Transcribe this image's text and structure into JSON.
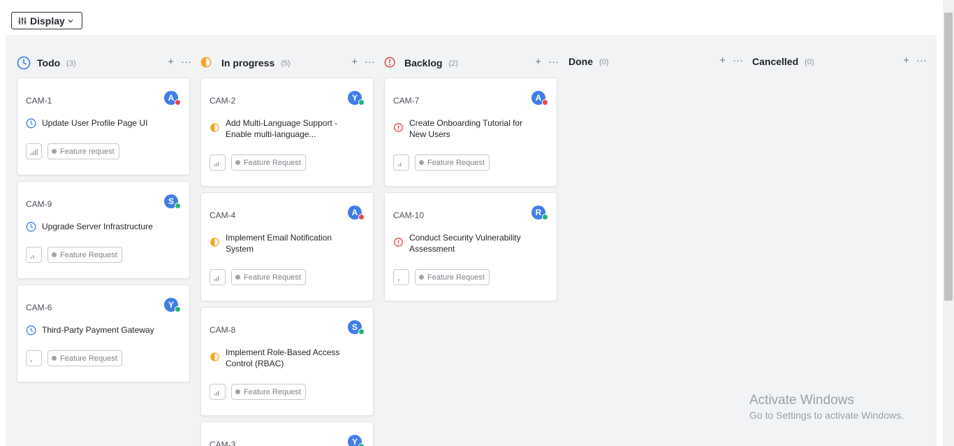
{
  "toolbar": {
    "display_label": "Display"
  },
  "columns": [
    {
      "key": "todo",
      "title": "Todo",
      "count": "(3)",
      "icon": "clock-icon",
      "color": "#3b7ddd",
      "cards": [
        {
          "id": "CAM-1",
          "title": "Update User Profile Page UI",
          "avatar": "A",
          "presence": "#e5484d",
          "priority": 4,
          "tag": "Feature request"
        },
        {
          "id": "CAM-9",
          "title": "Upgrade Server Infrastructure",
          "avatar": "S",
          "presence": "#22b573",
          "priority": 2,
          "tag": "Feature Request"
        },
        {
          "id": "CAM-6",
          "title": "Third-Party Payment Gateway",
          "avatar": "Y",
          "presence": "#22b573",
          "priority": 1,
          "tag": "Feature Request"
        }
      ]
    },
    {
      "key": "inprogress",
      "title": "In progress",
      "count": "(5)",
      "icon": "half-circle-icon",
      "color": "#f5a623",
      "cards": [
        {
          "id": "CAM-2",
          "title": "Add Multi-Language Support - Enable multi-language...",
          "avatar": "Y",
          "presence": "#22b573",
          "priority": 3,
          "tag": "Feature Request"
        },
        {
          "id": "CAM-4",
          "title": "Implement Email Notification System",
          "avatar": "A",
          "presence": "#e5484d",
          "priority": 3,
          "tag": "Feature Request"
        },
        {
          "id": "CAM-8",
          "title": "Implement Role-Based Access Control (RBAC)",
          "avatar": "S",
          "presence": "#22b573",
          "priority": 3,
          "tag": "Feature Request"
        },
        {
          "id": "CAM-3",
          "title": "",
          "avatar": "Y",
          "presence": "#22b573",
          "priority": 0,
          "tag": ""
        }
      ]
    },
    {
      "key": "backlog",
      "title": "Backlog",
      "count": "(2)",
      "icon": "alert-circle-icon",
      "color": "#e5484d",
      "cards": [
        {
          "id": "CAM-7",
          "title": "Create Onboarding Tutorial for New Users",
          "avatar": "A",
          "presence": "#e5484d",
          "priority": 2,
          "tag": "Feature Request"
        },
        {
          "id": "CAM-10",
          "title": "Conduct Security Vulnerability Assessment",
          "avatar": "R",
          "presence": "#22b573",
          "priority": 1,
          "tag": "Feature Request"
        }
      ]
    },
    {
      "key": "done",
      "title": "Done",
      "count": "(0)",
      "icon": "",
      "color": "",
      "cards": []
    },
    {
      "key": "cancelled",
      "title": "Cancelled",
      "count": "(0)",
      "icon": "",
      "color": "",
      "cards": []
    }
  ],
  "watermark": {
    "line1": "Activate Windows",
    "line2": "Go to Settings to activate Windows."
  }
}
